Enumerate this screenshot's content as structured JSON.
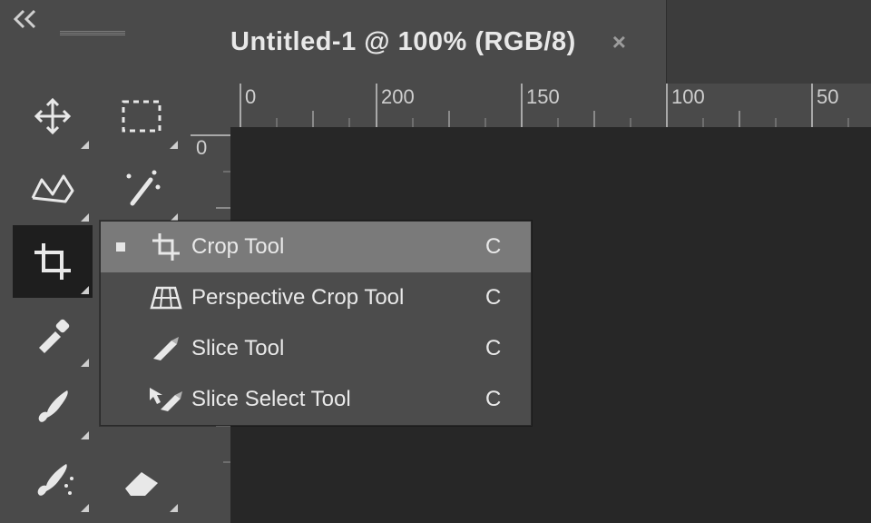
{
  "document": {
    "tab_title": "Untitled-1 @ 100% (RGB/8)"
  },
  "ruler": {
    "h_ticks": [
      "0",
      "200",
      "150",
      "100",
      "50"
    ],
    "v_ticks": [
      "0"
    ]
  },
  "flyout": {
    "items": [
      {
        "label": "Crop Tool",
        "shortcut": "C",
        "selected": true
      },
      {
        "label": "Perspective Crop Tool",
        "shortcut": "C",
        "selected": false
      },
      {
        "label": "Slice Tool",
        "shortcut": "C",
        "selected": false
      },
      {
        "label": "Slice Select Tool",
        "shortcut": "C",
        "selected": false
      }
    ]
  }
}
